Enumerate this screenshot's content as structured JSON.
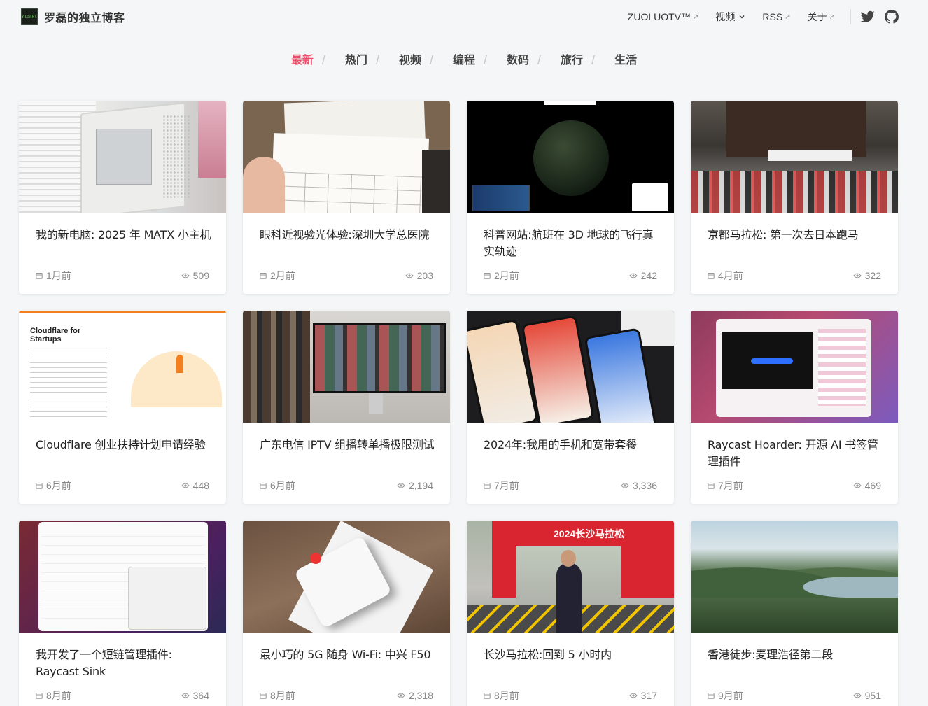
{
  "site": {
    "logo_text": "rlankl",
    "title": "罗磊的独立博客"
  },
  "nav": {
    "items": [
      {
        "label": "ZUOLUOTV™",
        "suffix": "↗"
      },
      {
        "label": "视频",
        "suffix": "chevron"
      },
      {
        "label": "RSS",
        "suffix": "↗"
      },
      {
        "label": "关于",
        "suffix": "↗"
      }
    ],
    "social": [
      "twitter-icon",
      "github-icon"
    ]
  },
  "tabs": {
    "items": [
      "最新",
      "热门",
      "视频",
      "编程",
      "数码",
      "旅行",
      "生活"
    ],
    "active": "最新",
    "separator": "/"
  },
  "colors": {
    "accent": "#e8506b",
    "background": "#f5f6f7",
    "card": "#ffffff",
    "meta": "#888888"
  },
  "posts": [
    {
      "title": "我的新电脑: 2025 年 MATX 小主机",
      "date": "1月前",
      "views": "509"
    },
    {
      "title": "眼科近视验光体验:深圳大学总医院",
      "date": "2月前",
      "views": "203"
    },
    {
      "title": "科普网站:航班在 3D 地球的飞行真实轨迹",
      "date": "2月前",
      "views": "242"
    },
    {
      "title": "京都马拉松: 第一次去日本跑马",
      "date": "4月前",
      "views": "322"
    },
    {
      "title": "Cloudflare 创业扶持计划申请经验",
      "date": "6月前",
      "views": "448",
      "thumb_text": "Cloudflare for Startups"
    },
    {
      "title": "广东电信 IPTV 组播转单播极限测试",
      "date": "6月前",
      "views": "2,194"
    },
    {
      "title": "2024年:我用的手机和宽带套餐",
      "date": "7月前",
      "views": "3,336"
    },
    {
      "title": "Raycast Hoarder: 开源 AI 书签管理插件",
      "date": "7月前",
      "views": "469"
    },
    {
      "title": "我开发了一个短链管理插件: Raycast Sink",
      "date": "8月前",
      "views": "364"
    },
    {
      "title": "最小巧的 5G 随身 Wi-Fi: 中兴 F50",
      "date": "8月前",
      "views": "2,318"
    },
    {
      "title": "长沙马拉松:回到 5 小时内",
      "date": "8月前",
      "views": "317",
      "thumb_text": "2024长沙马拉松"
    },
    {
      "title": "香港徒步:麦理浩径第二段",
      "date": "9月前",
      "views": "951"
    }
  ]
}
